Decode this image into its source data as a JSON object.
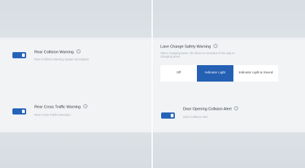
{
  "left_panel": {
    "rear_collision": {
      "title": "Rear Collision Warning",
      "description": "Rear Collision Warning System description",
      "enabled": true
    },
    "rear_cross_traffic": {
      "title": "Rear Cross Traffic Warning",
      "description": "Rear Cross Traffic Detection",
      "enabled": true
    }
  },
  "right_panel": {
    "lane_change": {
      "title": "Lane Change Safety Warning",
      "description_line1": "When changing lanes, the driver is reminded of the way to",
      "description_line2": "changing lanes",
      "options": [
        "Off",
        "Indicator Light",
        "Indicator Light & Sound"
      ],
      "selected": "Indicator Light"
    },
    "door_opening": {
      "title": "Door Opening Collision Alert",
      "description": "Door Collision Alert",
      "enabled": true
    }
  },
  "colors": {
    "accent": "#2460b3",
    "background": "#f1f3f5"
  }
}
